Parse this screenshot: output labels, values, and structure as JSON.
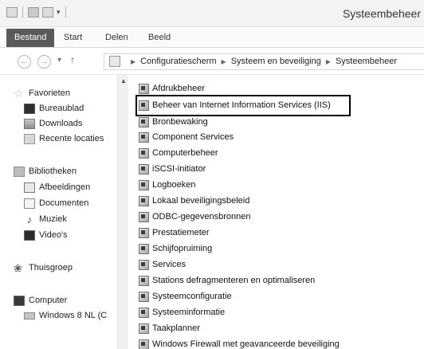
{
  "window": {
    "title": "Systeembeheer"
  },
  "ribbon": {
    "tabs": [
      "Bestand",
      "Start",
      "Delen",
      "Beeld"
    ]
  },
  "address": {
    "crumbs": [
      "Configuratiescherm",
      "Systeem en beveiliging",
      "Systeembeheer"
    ]
  },
  "nav": {
    "favorites_label": "Favorieten",
    "favorites": [
      "Bureaublad",
      "Downloads",
      "Recente locaties"
    ],
    "libraries_label": "Bibliotheken",
    "libraries": [
      "Afbeeldingen",
      "Documenten",
      "Muziek",
      "Video's"
    ],
    "homegroup_label": "Thuisgroep",
    "computer_label": "Computer",
    "computer": [
      "Windows 8 NL (C"
    ]
  },
  "content": {
    "items": [
      "Afdrukbeheer",
      "Beheer van Internet Information Services (IIS)",
      "Bronbewaking",
      "Component Services",
      "Computerbeheer",
      "iSCSI-initiator",
      "Logboeken",
      "Lokaal beveiligingsbeleid",
      "ODBC-gegevensbronnen",
      "Prestatiemeter",
      "Schijfopruiming",
      "Services",
      "Stations defragmenteren en optimaliseren",
      "Systeemconfiguratie",
      "Systeeminformatie",
      "Taakplanner",
      "Windows Firewall met geavanceerde beveiliging"
    ],
    "highlighted_index": 1
  }
}
